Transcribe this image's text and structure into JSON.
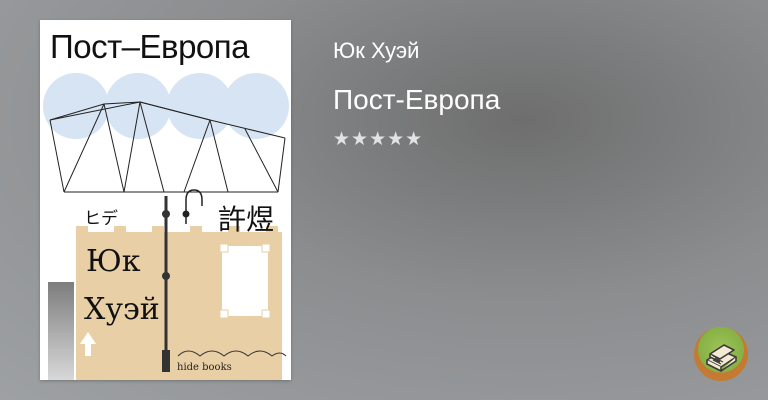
{
  "book": {
    "author": "Юк Хуэй",
    "title": "Пост-Европа",
    "rating": {
      "stars_total": 5,
      "stars_filled": 0,
      "glyph": "★★★★★"
    }
  },
  "cover": {
    "title": "Пост–Европа",
    "kana": "ヒデ",
    "kanji": "許煜",
    "author_line1": "Юк",
    "author_line2": "Хуэй",
    "publisher": "hide books",
    "colors": {
      "circles": "#d6e4f3",
      "tan": "#e8cfa5",
      "gray": "#8e8e8e"
    }
  },
  "badge": {
    "icon": "book-stack-icon",
    "color": "#86b144"
  }
}
